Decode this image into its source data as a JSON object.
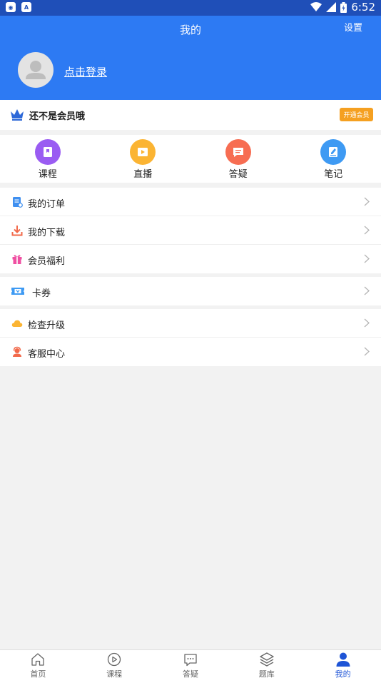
{
  "status_bar": {
    "time": "6:52",
    "left_icons": [
      "camera-app-icon",
      "a-app-icon"
    ]
  },
  "header": {
    "title": "我的",
    "settings_label": "设置",
    "login_label": "点击登录"
  },
  "vip": {
    "text": "还不是会员哦",
    "button_label": "开通会员",
    "accent": "#f5a021"
  },
  "quick_actions": [
    {
      "label": "课程",
      "icon": "course-book-icon",
      "color": "#9a5cf2"
    },
    {
      "label": "直播",
      "icon": "live-play-icon",
      "color": "#fbb433"
    },
    {
      "label": "答疑",
      "icon": "chat-bubble-icon",
      "color": "#f76d52"
    },
    {
      "label": "笔记",
      "icon": "note-pen-icon",
      "color": "#3e9af3"
    }
  ],
  "menu_group_1": [
    {
      "label": "我的订单",
      "icon": "order-icon"
    },
    {
      "label": "我的下载",
      "icon": "download-icon"
    },
    {
      "label": "会员福利",
      "icon": "gift-icon"
    }
  ],
  "menu_group_2": [
    {
      "label": "卡券",
      "icon": "coupon-icon"
    }
  ],
  "menu_group_3": [
    {
      "label": "检查升级",
      "icon": "cloud-icon"
    },
    {
      "label": "客服中心",
      "icon": "service-agent-icon"
    }
  ],
  "tab_bar": [
    {
      "label": "首页",
      "icon": "home-icon"
    },
    {
      "label": "课程",
      "icon": "play-circle-icon"
    },
    {
      "label": "答疑",
      "icon": "chat-icon"
    },
    {
      "label": "题库",
      "icon": "layers-icon"
    },
    {
      "label": "我的",
      "icon": "person-icon",
      "active": true
    }
  ],
  "colors": {
    "primary": "#2d7af3",
    "status_bar": "#1f4fb8",
    "active_tab": "#1e54d6"
  }
}
